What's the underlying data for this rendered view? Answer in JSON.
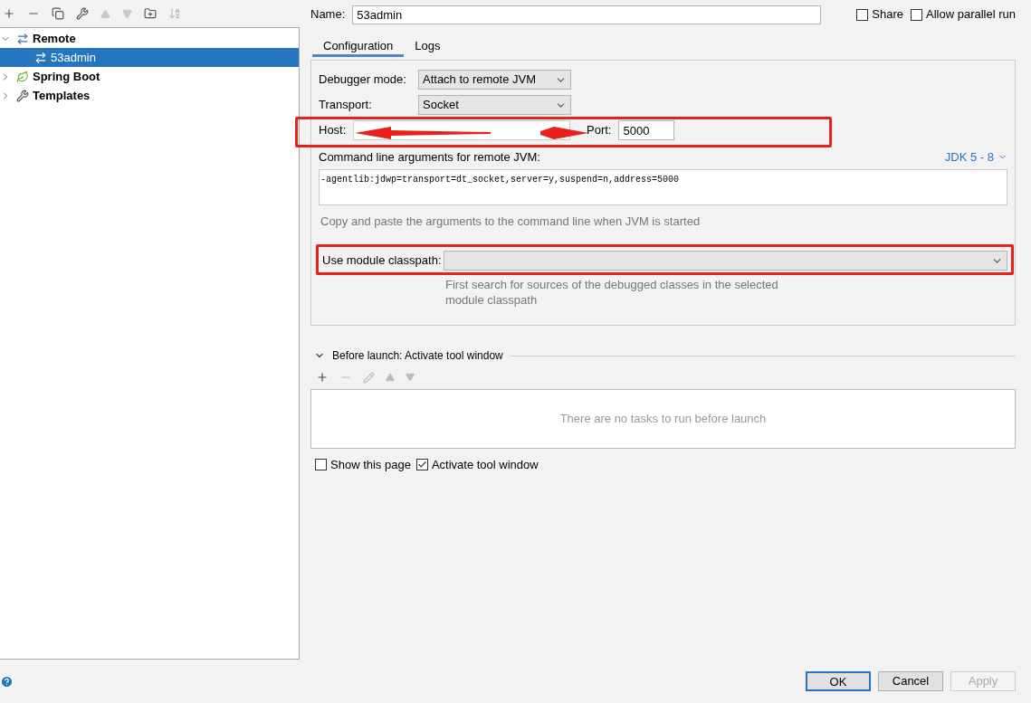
{
  "tree": [
    {
      "label": "Remote",
      "kind": "remote",
      "expanded": true,
      "selected": false,
      "children": [
        {
          "label": "53admin",
          "kind": "config",
          "selected": true
        }
      ]
    },
    {
      "label": "Spring Boot",
      "kind": "spring",
      "expanded": false,
      "selected": false
    },
    {
      "label": "Templates",
      "kind": "templates",
      "expanded": false,
      "selected": false
    }
  ],
  "name": {
    "label": "Name:",
    "value": "53admin"
  },
  "options": [
    {
      "label": "Share",
      "checked": false
    },
    {
      "label": "Allow parallel run",
      "checked": false
    }
  ],
  "tabs": [
    {
      "label": "Configuration",
      "selected": true
    },
    {
      "label": "Logs",
      "selected": false
    }
  ],
  "debugger_mode": {
    "label": "Debugger mode:",
    "value": "Attach to remote JVM"
  },
  "transport": {
    "label": "Transport:",
    "value": "Socket"
  },
  "host": {
    "label": "Host:"
  },
  "port": {
    "label": "Port:",
    "value": "5000"
  },
  "command_line": {
    "label": "Command line arguments for remote JVM:",
    "jdk": "JDK 5 - 8",
    "value": "-agentlib:jdwp=transport=dt_socket,server=y,suspend=n,address=5000",
    "hint": "Copy and paste the arguments to the command line when JVM is started"
  },
  "module_classpath": {
    "label": "Use module classpath:",
    "hint": "First search for sources of the debugged classes in the selected module classpath"
  },
  "before_launch": {
    "title": "Before launch: Activate tool window",
    "expanded": true,
    "empty_text": "There are no tasks to run before launch"
  },
  "bottom_options": [
    {
      "label": "Show this page",
      "checked": false
    },
    {
      "label": "Activate tool window",
      "checked": true
    }
  ],
  "buttons": [
    {
      "label": "OK",
      "default": true,
      "disabled": false
    },
    {
      "label": "Cancel",
      "default": false,
      "disabled": false
    },
    {
      "label": "Apply",
      "default": false,
      "disabled": true
    }
  ]
}
